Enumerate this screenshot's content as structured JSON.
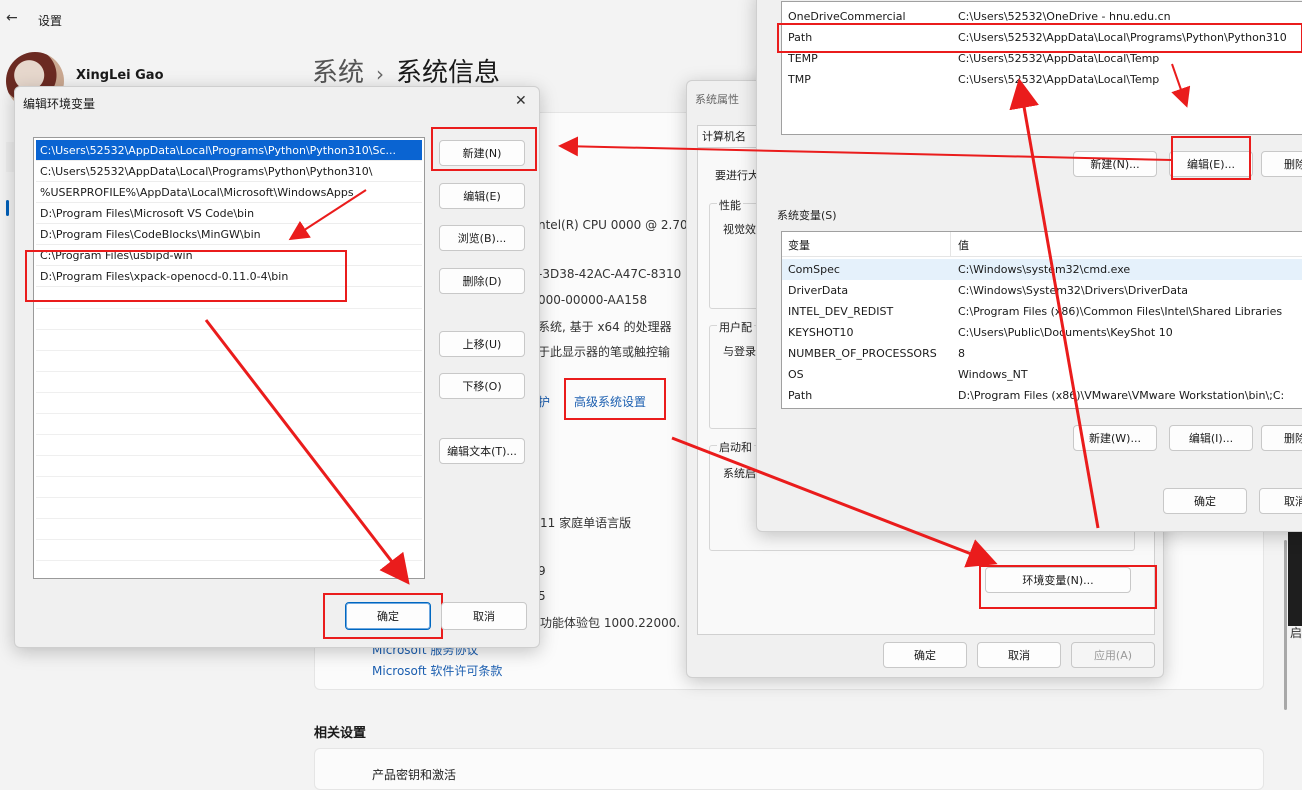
{
  "settings": {
    "title": "设置",
    "user_name": "XingLei Gao",
    "breadcrumb_parent": "系统",
    "breadcrumb_sep": "›",
    "breadcrumb_current": "系统信息",
    "cpu_fragment": "ntel(R) CPU 0000 @ 2.70",
    "id_fragment": "-3D38-42AC-A47C-8310",
    "product_fragment": "000-00000-AA158",
    "systype_fragment": "系统, 基于 x64 的处理器",
    "pen_fragment": "于此显示器的笔或触控输",
    "protect_fragment": "护",
    "advanced_link": "高级系统设置",
    "edition_fragment": "11 家庭单语言版",
    "frag_9": "9",
    "frag_5": "5",
    "experience_fragment": "功能体验包 1000.22000.",
    "services_link": "Microsoft 服务协议",
    "license_link": "Microsoft 软件许可条款",
    "related_title": "相关设置",
    "related_item": "产品密钥和激活",
    "right_fragment": "启"
  },
  "edit_dialog": {
    "title": "编辑环境变量",
    "close": "✕",
    "paths": [
      "C:\\Users\\52532\\AppData\\Local\\Programs\\Python\\Python310\\Sc...",
      "C:\\Users\\52532\\AppData\\Local\\Programs\\Python\\Python310\\",
      "%USERPROFILE%\\AppData\\Local\\Microsoft\\WindowsApps",
      "D:\\Program Files\\Microsoft VS Code\\bin",
      "D:\\Program Files\\CodeBlocks\\MinGW\\bin",
      "C:\\Program Files\\usbipd-win",
      "D:\\Program Files\\xpack-openocd-0.11.0-4\\bin"
    ],
    "buttons": {
      "new": "新建(N)",
      "edit": "编辑(E)",
      "browse": "浏览(B)...",
      "delete": "删除(D)",
      "move_up": "上移(U)",
      "move_down": "下移(O)",
      "edit_text": "编辑文本(T)..."
    },
    "ok": "确定",
    "cancel": "取消"
  },
  "system_properties": {
    "title": "系统属性",
    "tab_computer_name": "计算机名",
    "need_admin": "要进行大",
    "performance": "性能",
    "visual": "视觉效",
    "user_profiles": "用户配",
    "login": "与登录",
    "startup": "启动和",
    "system_startup": "系统启",
    "env_button": "环境变量(N)...",
    "ok": "确定",
    "cancel": "取消",
    "apply": "应用(A)"
  },
  "env_vars": {
    "user_vars": [
      {
        "name": "OneDriveCommercial",
        "value": "C:\\Users\\52532\\OneDrive - hnu.edu.cn"
      },
      {
        "name": "Path",
        "value": "C:\\Users\\52532\\AppData\\Local\\Programs\\Python\\Python310"
      },
      {
        "name": "TEMP",
        "value": "C:\\Users\\52532\\AppData\\Local\\Temp"
      },
      {
        "name": "TMP",
        "value": "C:\\Users\\52532\\AppData\\Local\\Temp"
      }
    ],
    "user_buttons": {
      "new": "新建(N)...",
      "edit": "编辑(E)...",
      "delete": "删除"
    },
    "system_label": "系统变量(S)",
    "col_var": "变量",
    "col_val": "值",
    "system_vars": [
      {
        "name": "ComSpec",
        "value": "C:\\Windows\\system32\\cmd.exe"
      },
      {
        "name": "DriverData",
        "value": "C:\\Windows\\System32\\Drivers\\DriverData"
      },
      {
        "name": "INTEL_DEV_REDIST",
        "value": "C:\\Program Files (x86)\\Common Files\\Intel\\Shared Libraries"
      },
      {
        "name": "KEYSHOT10",
        "value": "C:\\Users\\Public\\Documents\\KeyShot 10"
      },
      {
        "name": "NUMBER_OF_PROCESSORS",
        "value": "8"
      },
      {
        "name": "OS",
        "value": "Windows_NT"
      },
      {
        "name": "Path",
        "value": "D:\\Program Files (x86)\\VMware\\VMware Workstation\\bin\\;C:"
      }
    ],
    "system_buttons": {
      "new": "新建(W)...",
      "edit": "编辑(I)...",
      "delete": "删除"
    },
    "ok": "确定",
    "cancel": "取消"
  },
  "colors": {
    "annotation_red": "#ea1c1c",
    "selection_blue": "#0a64d2",
    "link_blue": "#1c5fb0"
  }
}
